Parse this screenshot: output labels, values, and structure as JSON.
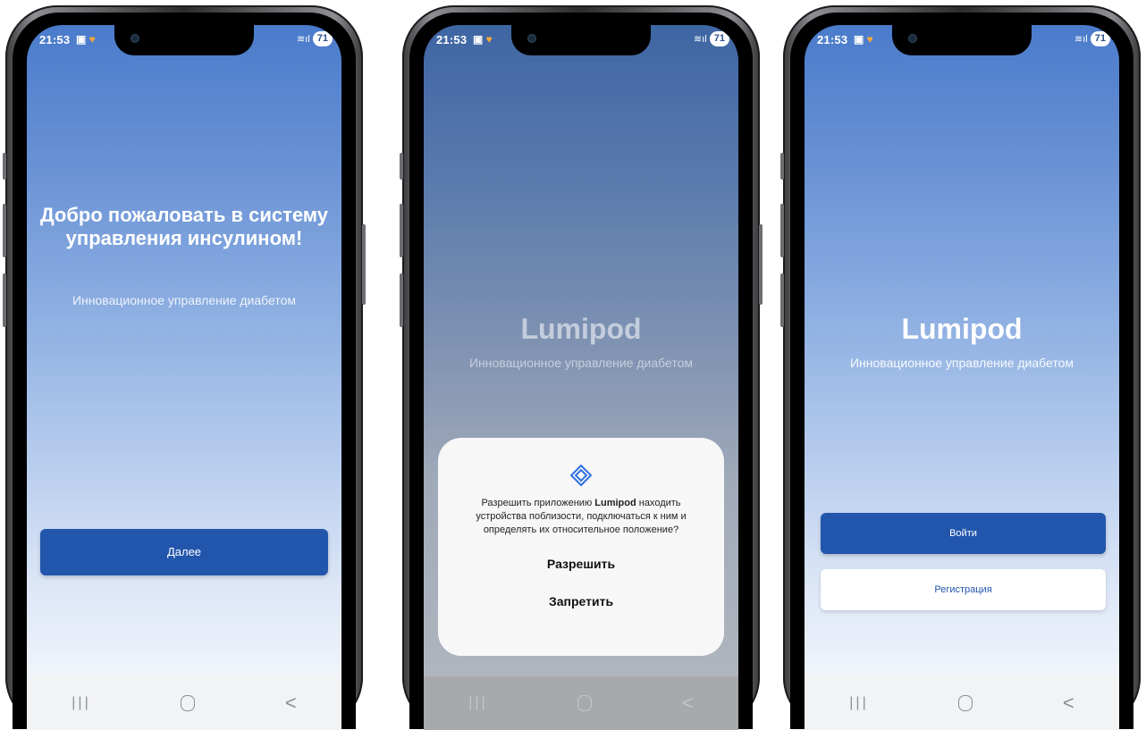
{
  "status_bar": {
    "time": "21:53",
    "battery": "71"
  },
  "screen1": {
    "title": "Добро пожаловать в систему управления инсулином!",
    "subtitle": "Инновационное управление диабетом",
    "next_button": "Далее"
  },
  "screen2": {
    "brand": "Lumipod",
    "subtitle": "Инновационное управление диабетом",
    "dialog": {
      "msg_prefix": "Разрешить приложению ",
      "app_name": "Lumipod",
      "msg_suffix": " находить устройства поблизости, подключаться к ним и определять их относительное положение?",
      "allow": "Разрешить",
      "deny": "Запретить"
    }
  },
  "screen3": {
    "brand": "Lumipod",
    "subtitle": "Инновационное управление диабетом",
    "login_button": "Войти",
    "register_button": "Регистрация"
  },
  "navbar": {
    "recent": "|||",
    "back": "<"
  },
  "colors": {
    "primary": "#2256ac",
    "gradient_top": "#4a7bcb",
    "gradient_bottom": "#f3f6fb"
  }
}
